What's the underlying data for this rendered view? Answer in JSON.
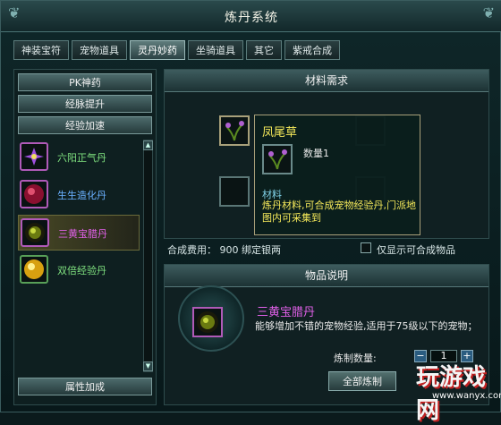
{
  "window": {
    "title": "炼丹系统"
  },
  "tabs": [
    {
      "label": "神装宝符"
    },
    {
      "label": "宠物道具"
    },
    {
      "label": "灵丹妙药",
      "active": true
    },
    {
      "label": "坐骑道具"
    },
    {
      "label": "其它"
    },
    {
      "label": "紫戒合成"
    }
  ],
  "sidebar": {
    "categories": [
      "PK神药",
      "经脉提升",
      "经验加速"
    ],
    "items": [
      {
        "label": "六阳正气丹",
        "icon": "purple-flower-icon"
      },
      {
        "label": "生生造化丹",
        "icon": "red-orb-icon"
      },
      {
        "label": "三黄宝腊丹",
        "icon": "green-orb-icon",
        "selected": true
      },
      {
        "label": "双倍经验丹",
        "icon": "gold-orb-icon"
      }
    ],
    "bottom_category": "属性加成"
  },
  "materials": {
    "heading": "材料需求"
  },
  "tooltip": {
    "name": "凤尾草",
    "quantity": "数量1",
    "type": "材料",
    "description": "炼丹材料,可合成宠物经验丹,门派地图内可采集到"
  },
  "cost": {
    "text": "合成费用： 900 绑定银两"
  },
  "filter": {
    "label": "仅显示可合成物品",
    "checked": false
  },
  "product": {
    "heading": "物品说明",
    "name": "三黄宝腊丹",
    "description": "能够增加不错的宠物经验,适用于75级以下的宠物；"
  },
  "craft": {
    "quantity_label": "炼制数量:",
    "quantity": "1",
    "all_button": "全部炼制",
    "minus": "−",
    "plus": "+"
  },
  "watermark": {
    "text": "玩游戏网",
    "url": "www.wanyx.com"
  },
  "colors": {
    "highlight": "#f5e95a",
    "product": "#e060e8",
    "type": "#7fd0e6"
  }
}
